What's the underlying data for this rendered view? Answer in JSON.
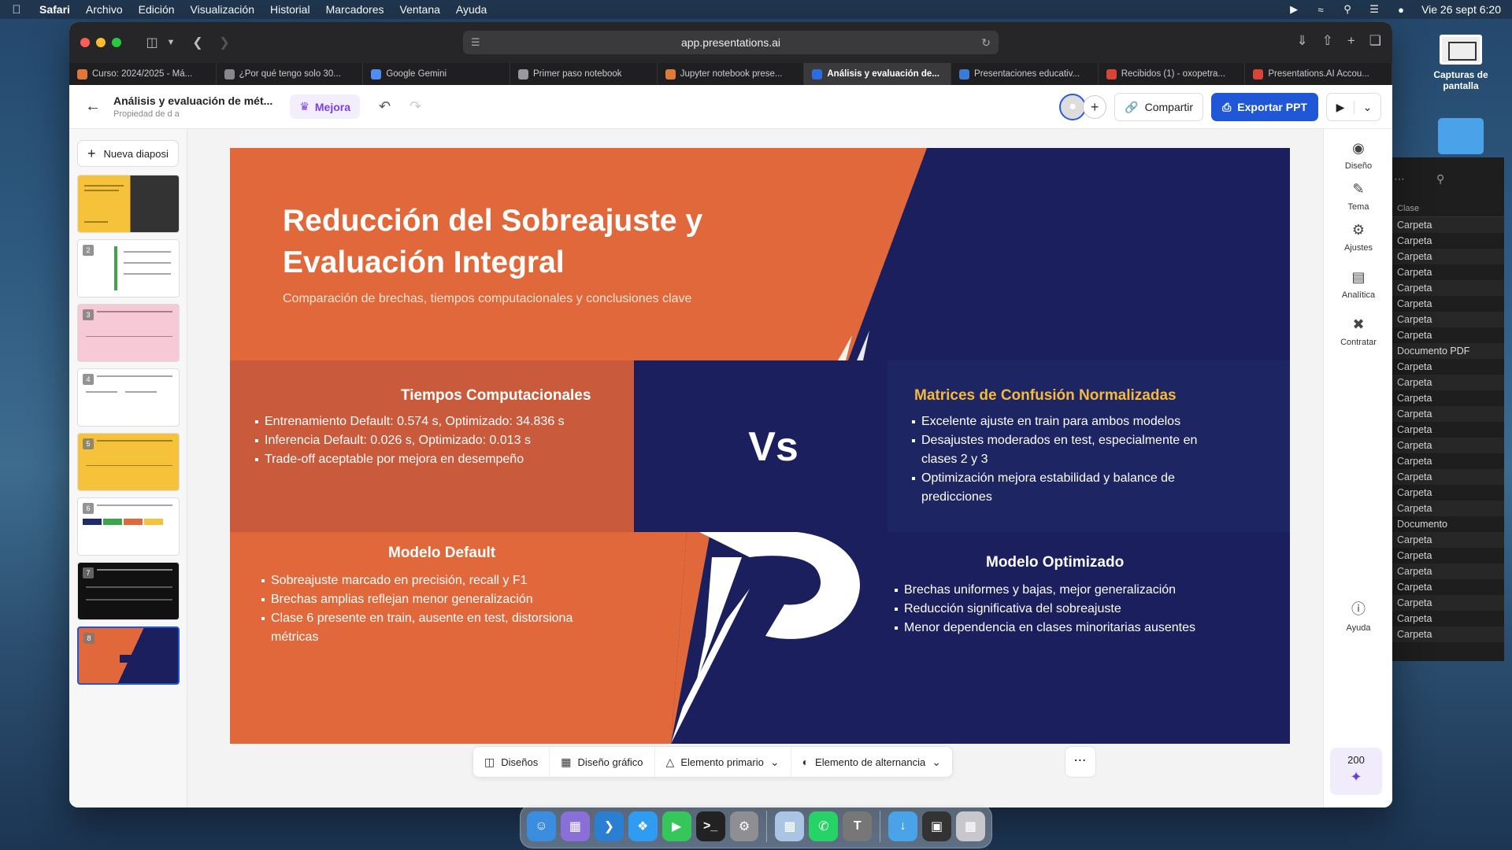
{
  "menubar": {
    "items": [
      "Safari",
      "Archivo",
      "Edición",
      "Visualización",
      "Historial",
      "Marcadores",
      "Ventana",
      "Ayuda"
    ],
    "datetime": "Vie 26 sept 6:20"
  },
  "desktop": {
    "capturas_label": "Capturas de pantalla"
  },
  "finder": {
    "column_header": "Clase",
    "rows": [
      "Carpeta",
      "Carpeta",
      "Carpeta",
      "Carpeta",
      "Carpeta",
      "Carpeta",
      "Carpeta",
      "Carpeta",
      "Documento PDF",
      "Carpeta",
      "Carpeta",
      "Carpeta",
      "Carpeta",
      "Carpeta",
      "Carpeta",
      "Carpeta",
      "Carpeta",
      "Carpeta",
      "Carpeta",
      "Documento",
      "Carpeta",
      "Carpeta",
      "Carpeta",
      "Carpeta",
      "Carpeta",
      "Carpeta",
      "Carpeta"
    ]
  },
  "browser": {
    "url": "app.presentations.ai",
    "tabs": [
      {
        "label": "Curso: 2024/2025 - Má...",
        "color": "#e0773a"
      },
      {
        "label": "¿Por qué tengo solo 30...",
        "color": "#888888"
      },
      {
        "label": "Google Gemini",
        "color": "#4f8df5"
      },
      {
        "label": "Primer paso notebook",
        "color": "#999999"
      },
      {
        "label": "Jupyter notebook prese...",
        "color": "#e07a3a"
      },
      {
        "label": "Análisis y evaluación de...",
        "color": "#2a6de0",
        "active": true
      },
      {
        "label": "Presentaciones educativ...",
        "color": "#3a7bd5"
      },
      {
        "label": "Recibidos (1) - oxopetra...",
        "color": "#d64535"
      },
      {
        "label": "Presentations.AI Accou...",
        "color": "#d64535"
      }
    ]
  },
  "app": {
    "doc_title": "Análisis y evaluación de mét...",
    "doc_subtitle": "Propiedad de d a",
    "upgrade_label": "Mejora",
    "share_label": "Compartir",
    "export_label": "Exportar PPT",
    "new_slide_label": "Nueva diaposi",
    "slide_count": 8,
    "active_slide": 8
  },
  "slide": {
    "title": "Reducción del Sobreajuste y Evaluación Integral",
    "subtitle": "Comparación de brechas, tiempos computacionales y conclusiones clave",
    "vs": "Vs",
    "times_title": "Tiempos Computacionales",
    "times_bullets": [
      "Entrenamiento Default: 0.574 s, Optimizado: 34.836 s",
      "Inferencia Default: 0.026 s, Optimizado: 0.013 s",
      "Trade-off aceptable por mejora en desempeño"
    ],
    "matrices_title": "Matrices de Confusión Normalizadas",
    "matrices_bullets": [
      "Excelente ajuste en train para ambos modelos",
      "Desajustes moderados en test, especialmente en clases 2 y 3",
      "Optimización mejora estabilidad y balance de predicciones"
    ],
    "default_title": "Modelo Default",
    "default_bullets": [
      "Sobreajuste marcado en precisión, recall y F1",
      "Brechas amplias reflejan menor generalización",
      "Clase 6 presente en train, ausente en test, distorsiona métricas"
    ],
    "optimized_title": "Modelo Optimizado",
    "optimized_bullets": [
      "Brechas uniformes y bajas, mejor generalización",
      "Reducción significativa del sobreajuste",
      "Menor dependencia en clases minoritarias ausentes"
    ],
    "colors": {
      "orange": "#e0683a",
      "orange_dark": "#c95a3b",
      "navy": "#1c1f5e",
      "navy_panel": "#1d2563",
      "accent_yellow": "#f6b93b"
    }
  },
  "bottom_toolbar": {
    "designs": "Diseños",
    "graphic_design": "Diseño gráfico",
    "primary_element": "Elemento primario",
    "alternation_element": "Elemento de alternancia"
  },
  "right_tools": {
    "design": "Diseño",
    "theme": "Tema",
    "settings": "Ajustes",
    "analytics": "Analítica",
    "hire": "Contratar",
    "help": "Ayuda",
    "credits": "200"
  }
}
